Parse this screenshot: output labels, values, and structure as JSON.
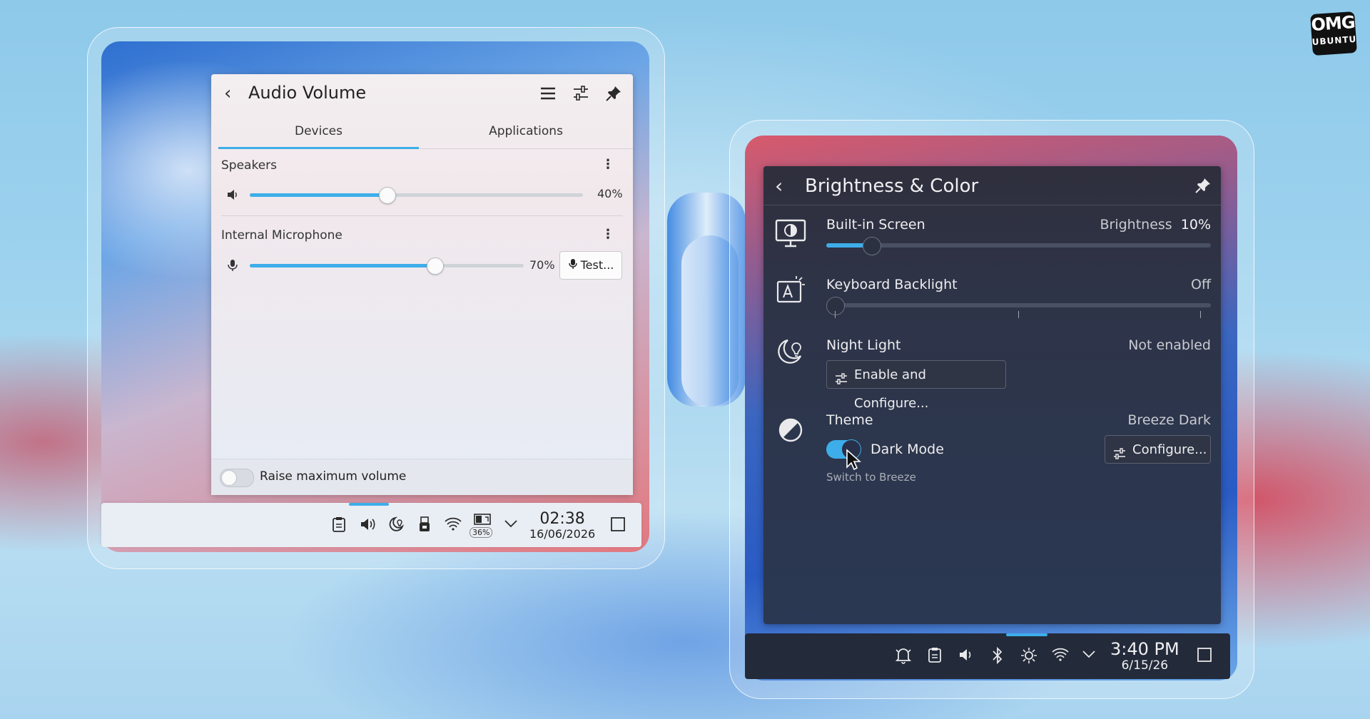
{
  "logo": {
    "line1": "OMG",
    "line2": "UBUNTU"
  },
  "audio": {
    "title": "Audio Volume",
    "tabs": [
      {
        "label": "Devices",
        "active": true
      },
      {
        "label": "Applications",
        "active": false
      }
    ],
    "devices": [
      {
        "label": "Speakers",
        "volume_percent": 40,
        "volume_text": "40%"
      },
      {
        "label": "Internal Microphone",
        "volume_percent": 70,
        "volume_text": "70%",
        "action": "Test..."
      }
    ],
    "footer": {
      "label": "Raise maximum volume",
      "enabled": false
    }
  },
  "taskbar_left": {
    "battery_badge": "36%",
    "time": "02:38",
    "date": "16/06/2026"
  },
  "brightness": {
    "title": "Brightness & Color",
    "rows": [
      {
        "label": "Built-in Screen",
        "value_prefix": "Brightness",
        "value": "10%",
        "level": 0.1
      },
      {
        "label": "Keyboard Backlight",
        "value": "Off",
        "level": 0
      },
      {
        "label": "Night Light",
        "value": "Not enabled",
        "button": "Enable and Configure..."
      },
      {
        "label": "Theme",
        "value": "Breeze Dark",
        "toggle_label": "Dark Mode",
        "toggle_on": true,
        "sub": "Switch to Breeze",
        "button": "Configure..."
      }
    ]
  },
  "taskbar_right": {
    "time": "3:40 PM",
    "date": "6/15/26"
  },
  "colors": {
    "accent": "#3daee9",
    "dark_panel": "#2e3448",
    "light_panel": "#f1e8ec"
  }
}
